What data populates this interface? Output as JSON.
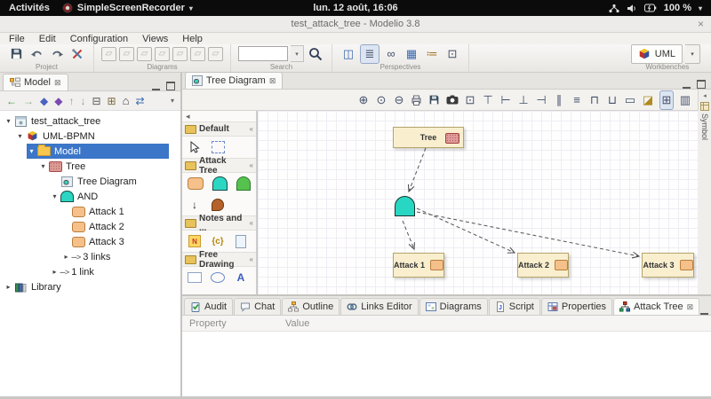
{
  "system_bar": {
    "activities_label": "Activités",
    "recorder_label": "SimpleScreenRecorder",
    "clock": "lun. 12 août, 16:06",
    "battery_percent": "100 %"
  },
  "window": {
    "title": "test_attack_tree - Modelio 3.8",
    "close": "×"
  },
  "menu_bar": {
    "items": [
      "File",
      "Edit",
      "Configuration",
      "Views",
      "Help"
    ]
  },
  "main_toolbar": {
    "groups": {
      "project": "Project",
      "diagrams": "Diagrams",
      "search": "Search",
      "perspectives": "Perspectives",
      "workbenches": "Workbenches"
    },
    "search_value": "",
    "workbench_value": "UML"
  },
  "model_panel": {
    "tab_label": "Model",
    "tree": [
      {
        "label": "test_attack_tree",
        "level": 0,
        "expander": "▾",
        "icon": "project"
      },
      {
        "label": "UML-BPMN",
        "level": 1,
        "expander": "▾",
        "icon": "uml-cube"
      },
      {
        "label": "Model",
        "level": 2,
        "expander": "▾",
        "icon": "folder",
        "selected": true
      },
      {
        "label": "Tree",
        "level": 3,
        "expander": "▾",
        "icon": "tree-node"
      },
      {
        "label": "Tree Diagram",
        "level": 4,
        "expander": "",
        "icon": "diagram"
      },
      {
        "label": "AND",
        "level": 4,
        "expander": "▾",
        "icon": "and-gate"
      },
      {
        "label": "Attack 1",
        "level": 5,
        "expander": "",
        "icon": "attack"
      },
      {
        "label": "Attack 2",
        "level": 5,
        "expander": "",
        "icon": "attack"
      },
      {
        "label": "Attack 3",
        "level": 5,
        "expander": "",
        "icon": "attack"
      },
      {
        "label": "3 links",
        "level": 5,
        "expander": "▸",
        "icon": "link"
      },
      {
        "label": "1 link",
        "level": 4,
        "expander": "▸",
        "icon": "link"
      },
      {
        "label": "Library",
        "level": 0,
        "expander": "▸",
        "icon": "library"
      }
    ]
  },
  "editor": {
    "tab_label": "Tree Diagram",
    "symbol_tab_label": "Symbol"
  },
  "palette": {
    "groups": [
      {
        "label": "Default"
      },
      {
        "label": "Attack Tree"
      },
      {
        "label": "Notes and ..."
      },
      {
        "label": "Free Drawing"
      }
    ]
  },
  "diagram": {
    "tree_label": "Tree",
    "attack1_label": "Attack 1",
    "attack2_label": "Attack 2",
    "attack3_label": "Attack 3"
  },
  "bottom_panel": {
    "tabs": [
      "Audit",
      "Chat",
      "Outline",
      "Links Editor",
      "Diagrams",
      "Script",
      "Properties",
      "Attack Tree"
    ],
    "active_tab": "Attack Tree",
    "columns": [
      "Property",
      "Value"
    ]
  },
  "icons": {
    "tab_close": "⊠",
    "view_menu": "▾",
    "nav_back": "←",
    "nav_forward": "→",
    "nav_prev": "◆",
    "nav_next": "◆",
    "nav_up": "↑",
    "nav_down": "↓",
    "collapse_all": "⊟",
    "link_with_editor": "⊞",
    "home": "⌂",
    "refresh": "⇄",
    "search_dropdown": "▾",
    "perspective_1": "◫",
    "perspective_2": "≣",
    "perspective_3": "∞",
    "perspective_4": "▦",
    "perspective_5": "≔",
    "perspective_6": "⊡",
    "zoom_in": "⊕",
    "zoom_actual": "⊙",
    "zoom_out": "⊖",
    "zoom_area": "⊡",
    "align_top": "⊤",
    "align_left": "⊢",
    "align_bottom": "⊥",
    "align_right": "⊣",
    "distribute_h": "∥",
    "distribute_v": "≡",
    "same_width": "⊓",
    "same_height": "⊔",
    "same_size": "▭",
    "format_painter": "◪",
    "grid": "⊞",
    "overview": "▥",
    "palette_collapse": "◂",
    "palette_group_toggle": "«",
    "tool_arrow_down": "↓",
    "tool_text": "A",
    "tool_line": "→",
    "tool_constraint": "{c}",
    "tool_note": "N",
    "link_arrow": "--->",
    "close_window": "×",
    "diagram_placeholder": "▱"
  },
  "colors": {
    "selection_blue": "#3b76c8",
    "node_fill": "#f9efcf",
    "node_border": "#b5a46b",
    "and_gate_fill": "#28d7c3",
    "attack_icon_fill": "#f5c089",
    "tree_icon_fill": "#dc9a94"
  }
}
